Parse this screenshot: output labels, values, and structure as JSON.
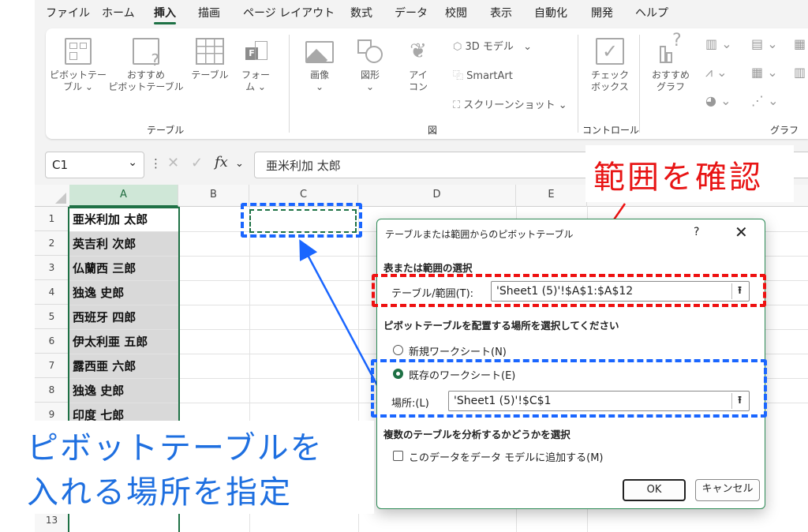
{
  "menu": {
    "items": [
      "ファイル",
      "ホーム",
      "挿入",
      "描画",
      "ページ レイアウト",
      "数式",
      "データ",
      "校閲",
      "表示",
      "自動化",
      "開発",
      "ヘルプ"
    ],
    "active": "挿入"
  },
  "ribbon": {
    "pivot_table_line1": "ピボットテー",
    "pivot_table_line2": "ブル ⌄",
    "recommended_pivot_line1": "おすすめ",
    "recommended_pivot_line2": "ピボットテーブル",
    "table": "テーブル",
    "forms_line1": "フォー",
    "forms_line2": "ム ⌄",
    "group_table": "テーブル",
    "images": "画像",
    "images_arrow": "⌄",
    "shapes": "図形",
    "shapes_arrow": "⌄",
    "icons_line1": "アイ",
    "icons_line2": "コン",
    "models_3d": "3D モデル",
    "smartart": "SmartArt",
    "screenshot": "スクリーンショット",
    "group_illustrations": "図",
    "checkbox_line1": "チェック",
    "checkbox_line2": "ボックス",
    "group_controls": "コントロール",
    "recommended_charts_line1": "おすすめ",
    "recommended_charts_line2": "グラフ",
    "group_charts": "グラフ"
  },
  "formula_bar": {
    "name_box": "C1",
    "fx": "fx",
    "value": "亜米利加 太郎"
  },
  "grid": {
    "columns": [
      "A",
      "B",
      "C",
      "D",
      "E"
    ],
    "rows": [
      "1",
      "2",
      "3",
      "4",
      "5",
      "6",
      "7",
      "8",
      "9",
      "13"
    ],
    "col_a_values": [
      "亜米利加 太郎",
      "英吉利 次郎",
      "仏蘭西 三郎",
      "独逸 史郎",
      "西班牙 四郎",
      "伊太利亜 五郎",
      "露西亜 六郎",
      "独逸 史郎",
      "印度 七郎"
    ]
  },
  "dialog": {
    "title": "テーブルまたは範囲からのピボットテーブル",
    "help": "?",
    "close": "✕",
    "section_source": "表または範囲の選択",
    "table_range_label": "テーブル/範囲(T):",
    "table_range_value": "'Sheet1 (5)'!$A$1:$A$12",
    "section_location": "ピボットテーブルを配置する場所を選択してください",
    "new_sheet": "新規ワークシート(N)",
    "existing_sheet": "既存のワークシート(E)",
    "location_label": "場所:(L)",
    "location_value": "'Sheet1 (5)'!$C$1",
    "section_multi": "複数のテーブルを分析するかどうかを選択",
    "add_to_model": "このデータをデータ モデルに追加する(M)",
    "ok": "OK",
    "cancel": "キャンセル"
  },
  "annotations": {
    "check_range": "範囲を確認",
    "note_line1": "ピボットテーブルを",
    "note_line2": "入れる場所を指定"
  },
  "colors": {
    "accent": "#1e7145",
    "annotation_blue": "#1a66ff",
    "annotation_red": "#ee1111"
  }
}
